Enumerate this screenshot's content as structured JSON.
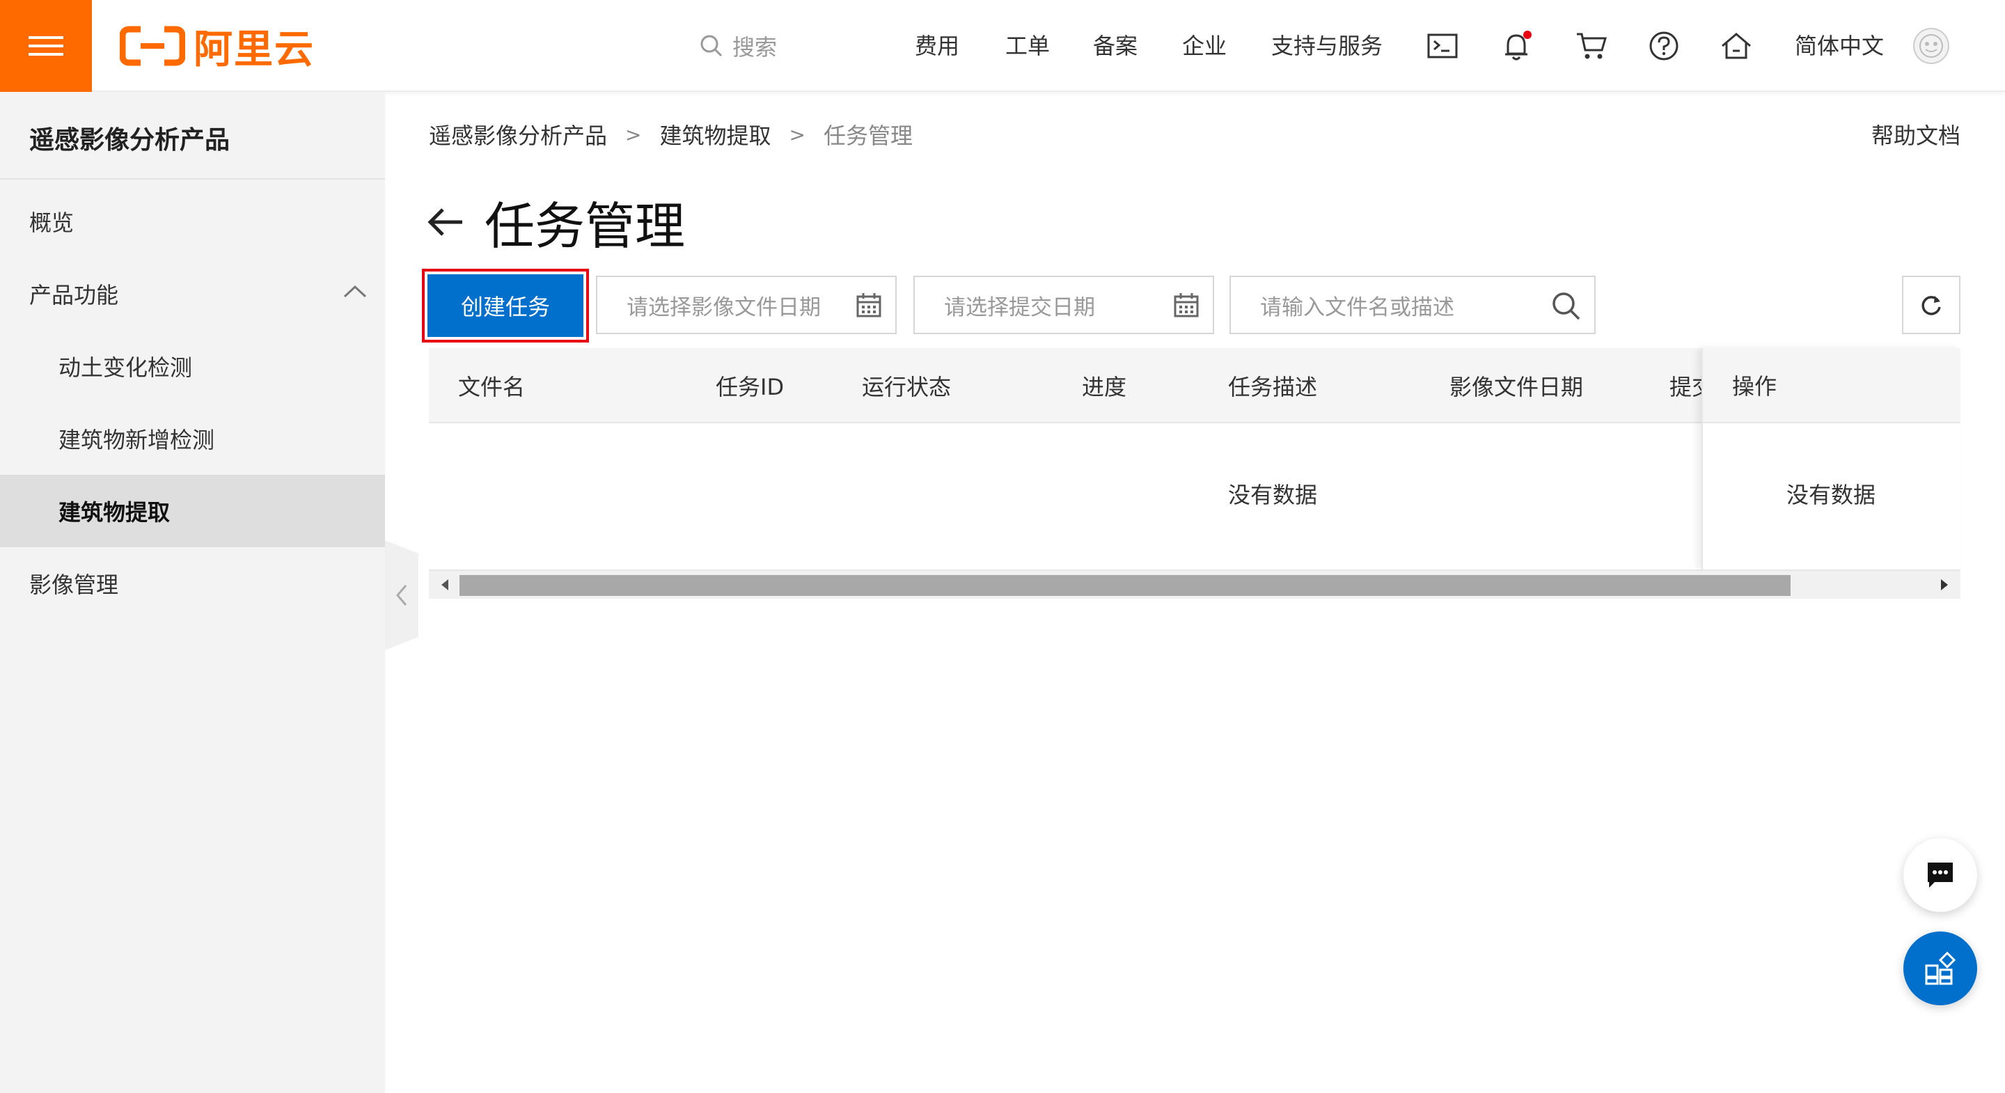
{
  "header": {
    "logo_text": "阿里云",
    "search_placeholder": "搜索",
    "nav": {
      "fees": "费用",
      "tickets": "工单",
      "icp": "备案",
      "enterprise": "企业",
      "support": "支持与服务",
      "language": "简体中文"
    },
    "notification_dot_color": "#e60012",
    "brand_color": "#ff6a00"
  },
  "sidebar": {
    "title": "遥感影像分析产品",
    "items": [
      {
        "label": "概览",
        "level": 1
      },
      {
        "label": "产品功能",
        "level": 1,
        "expanded": true
      },
      {
        "label": "动土变化检测",
        "level": 2
      },
      {
        "label": "建筑物新增检测",
        "level": 2
      },
      {
        "label": "建筑物提取",
        "level": 2,
        "active": true
      },
      {
        "label": "影像管理",
        "level": 1
      }
    ]
  },
  "breadcrumb": [
    "遥感影像分析产品",
    "建筑物提取",
    "任务管理"
  ],
  "help_doc": "帮助文档",
  "page_title": "任务管理",
  "toolbar": {
    "create_label": "创建任务",
    "image_date_placeholder": "请选择影像文件日期",
    "submit_date_placeholder": "请选择提交日期",
    "search_placeholder": "请输入文件名或描述"
  },
  "table": {
    "columns": [
      "文件名",
      "任务ID",
      "运行状态",
      "进度",
      "任务描述",
      "影像文件日期",
      "提交"
    ],
    "fixed_column": "操作",
    "empty_text": "没有数据",
    "fixed_empty_text": "没有数据"
  },
  "accent_color": "#0070cc"
}
